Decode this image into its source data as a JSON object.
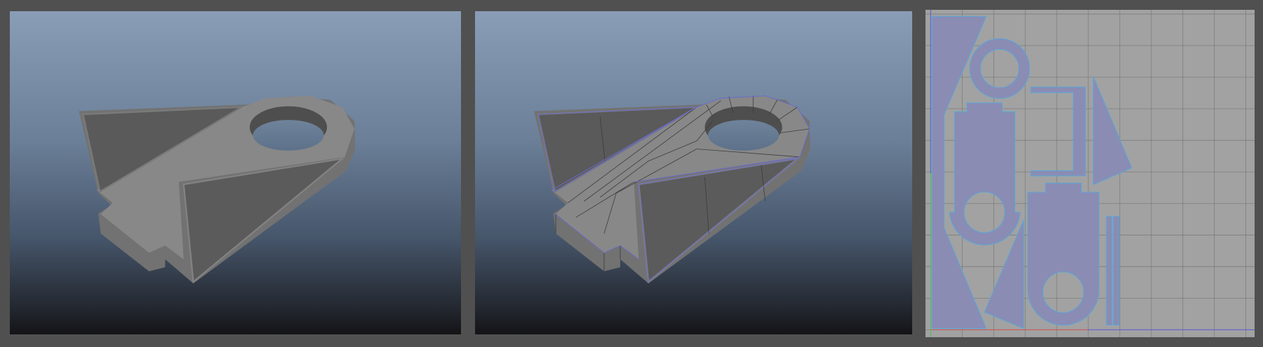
{
  "colors": {
    "background": "#505050",
    "viewport_top": "#8a9db6",
    "viewport_bottom": "#141417",
    "uv_background": "#a2a2a2",
    "uv_shell_fill": "#8a8cb4",
    "uv_shell_edge": "#5aa8d8",
    "mesh_top": "#888888",
    "mesh_wall": "#5a5a5a"
  }
}
